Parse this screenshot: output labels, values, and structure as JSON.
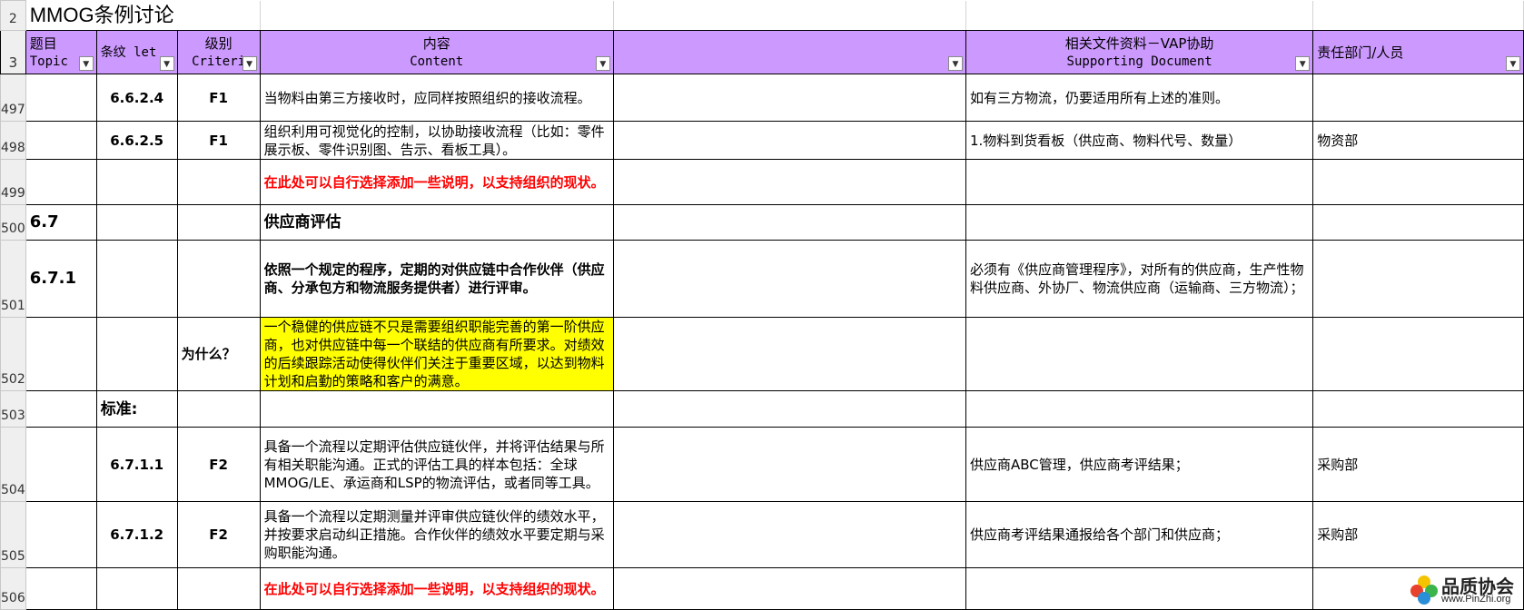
{
  "title": "MMOG条例讨论",
  "row_numbers": [
    "2",
    "3",
    "497",
    "498",
    "499",
    "500",
    "501",
    "502",
    "503",
    "504",
    "505",
    "506"
  ],
  "headers": {
    "topic": {
      "line1": "题目",
      "line2": "Topic"
    },
    "clause": {
      "line1": "条纹 let"
    },
    "criteria": {
      "line1": "级别",
      "line2": "Criteri"
    },
    "content": {
      "line1": "内容",
      "line2": "Content"
    },
    "supporting": {
      "line1": "相关文件资料－VAP协助",
      "line2": "Supporting Document"
    },
    "responsible": {
      "line1": "责任部门/人员"
    }
  },
  "rows": {
    "r497": {
      "clause": "6.6.2.4",
      "criteria": "F1",
      "content": "当物料由第三方接收时，应同样按照组织的接收流程。",
      "supporting": "如有三方物流，仍要适用所有上述的准则。",
      "responsible": ""
    },
    "r498": {
      "clause": "6.6.2.5",
      "criteria": "F1",
      "content": "组织利用可视觉化的控制，以协助接收流程（比如：零件展示板、零件识别图、告示、看板工具）。",
      "supporting": "1.物料到货看板（供应商、物料代号、数量）",
      "responsible": "物资部"
    },
    "r499": {
      "content": "在此处可以自行选择添加一些说明，以支持组织的现状。"
    },
    "r500": {
      "topic": "6.7",
      "content": "供应商评估"
    },
    "r501": {
      "topic": "6.7.1",
      "content": "依照一个规定的程序，定期的对供应链中合作伙伴（供应商、分承包方和物流服务提供者）进行评审。",
      "supporting": "必须有《供应商管理程序》，对所有的供应商，生产性物料供应商、外协厂、物流供应商（运输商、三方物流）；"
    },
    "r502": {
      "criteria": "为什么？",
      "content": "一个稳健的供应链不只是需要组织职能完善的第一阶供应商，也对供应链中每一个联结的供应商有所要求。对绩效的后续跟踪活动使得伙伴们关注于重要区域，以达到物料计划和启勤的策略和客户的满意。"
    },
    "r503": {
      "clause": "标准:"
    },
    "r504": {
      "clause": "6.7.1.1",
      "criteria": "F2",
      "content": "具备一个流程以定期评估供应链伙伴，并将评估结果与所有相关职能沟通。正式的评估工具的样本包括：全球MMOG/LE、承运商和LSP的物流评估，或者同等工具。",
      "supporting": "供应商ABC管理，供应商考评结果；",
      "responsible": "采购部"
    },
    "r505": {
      "clause": "6.7.1.2",
      "criteria": "F2",
      "content": "具备一个流程以定期测量并评审供应链伙伴的绩效水平，并按要求启动纠正措施。合作伙伴的绩效水平要定期与采购职能沟通。",
      "supporting": "供应商考评结果通报给各个部门和供应商；",
      "responsible": "采购部"
    },
    "r506": {
      "content": "在此处可以自行选择添加一些说明，以支持组织的现状。"
    }
  },
  "watermark": {
    "name": "品质协会",
    "url": "www.PinZhi.org"
  },
  "colors": {
    "header": "#cc99ff",
    "highlight": "#ffff00",
    "note_red": "#ff0000"
  }
}
